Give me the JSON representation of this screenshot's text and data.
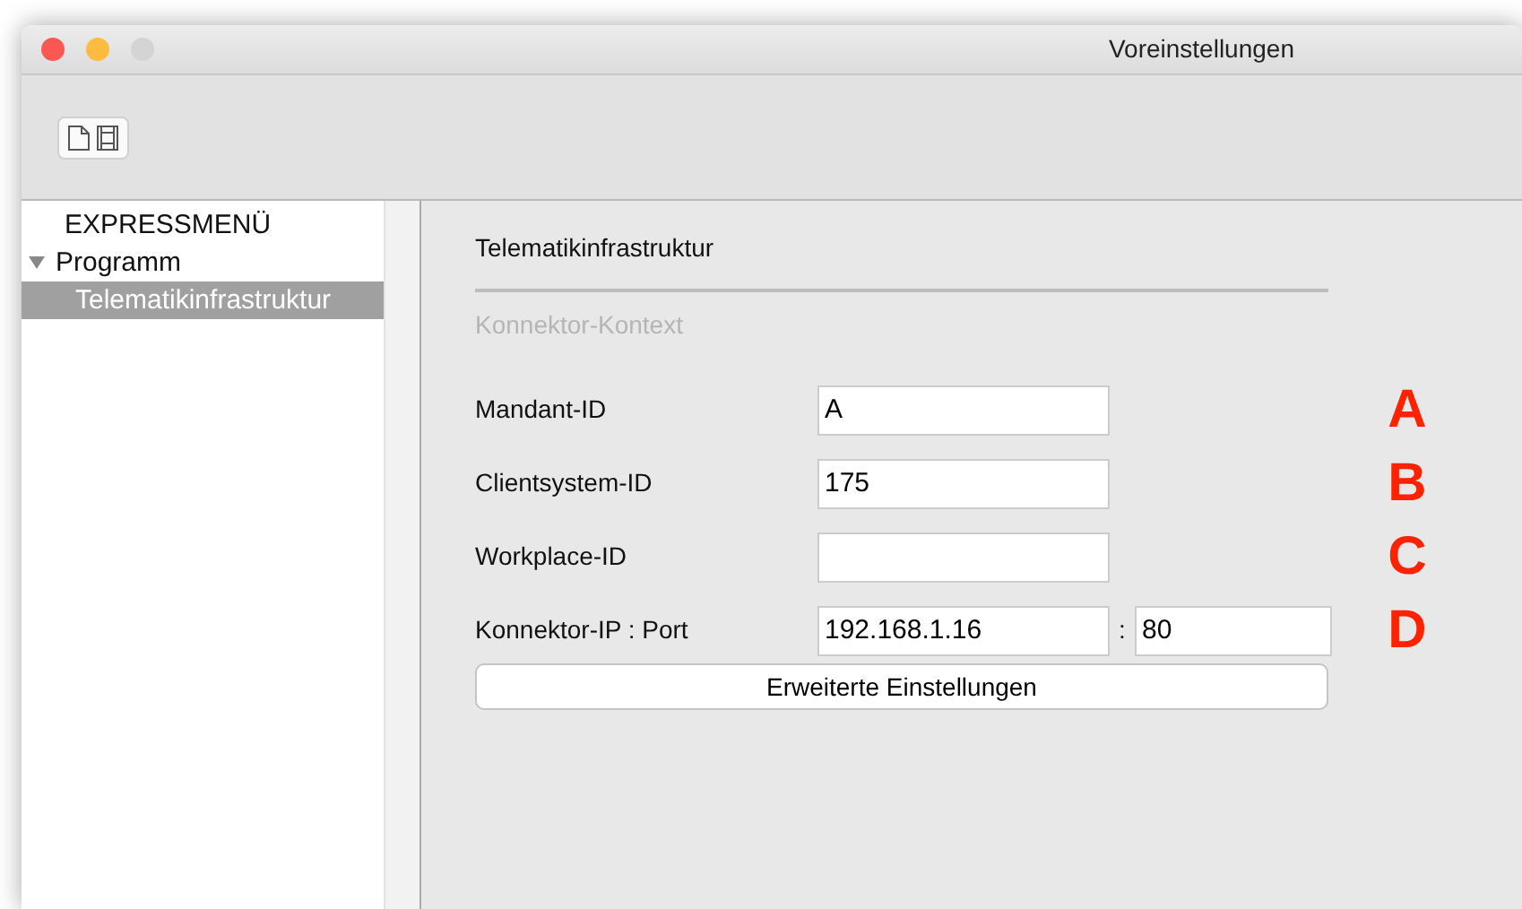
{
  "window": {
    "title": "Voreinstellungen"
  },
  "sidebar": {
    "items": [
      {
        "label": "EXPRESSMENÜ",
        "selected": false
      },
      {
        "label": "Programm",
        "selected": false,
        "expanded": true,
        "children": [
          {
            "label": "Telematikinfrastruktur",
            "selected": true
          }
        ]
      }
    ]
  },
  "panel": {
    "title": "Telematikinfrastruktur",
    "section": "Konnektor-Kontext",
    "fields": [
      {
        "label": "Mandant-ID",
        "value": "A",
        "marker": "A"
      },
      {
        "label": "Clientsystem-ID",
        "value": "175",
        "marker": "B"
      },
      {
        "label": "Workplace-ID",
        "marker": "C"
      },
      {
        "label": "Konnektor-IP : Port",
        "value": "192.168.1.16",
        "separator": ":",
        "port": "80",
        "marker": "D"
      }
    ],
    "button": "Erweiterte Einstellungen"
  }
}
